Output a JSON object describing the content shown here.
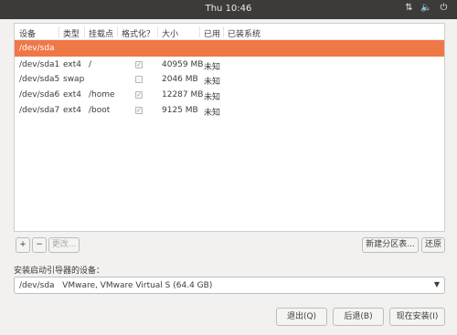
{
  "topbar": {
    "clock": "Thu 10:46",
    "icons": [
      "network-icon",
      "volume-icon",
      "power-icon"
    ]
  },
  "table": {
    "headers": [
      "设备",
      "类型",
      "挂载点",
      "格式化？",
      "大小",
      "已用",
      "已装系统"
    ],
    "selected_row": "/dev/sda",
    "rows": [
      {
        "device": "/dev/sda1",
        "type": "ext4",
        "mount": "/",
        "format": true,
        "size": "40959 MB",
        "used": "未知",
        "system": ""
      },
      {
        "device": "/dev/sda5",
        "type": "swap",
        "mount": "",
        "format": false,
        "size": "2046 MB",
        "used": "未知",
        "system": ""
      },
      {
        "device": "/dev/sda6",
        "type": "ext4",
        "mount": "/home",
        "format": true,
        "size": "12287 MB",
        "used": "未知",
        "system": ""
      },
      {
        "device": "/dev/sda7",
        "type": "ext4",
        "mount": "/boot",
        "format": true,
        "size": "9125 MB",
        "used": "未知",
        "system": ""
      }
    ]
  },
  "toolbar": {
    "add": "+",
    "remove": "−",
    "change": "更改...",
    "new_table": "新建分区表...",
    "revert": "还原"
  },
  "bootloader": {
    "label": "安装启动引导器的设备：",
    "device": "/dev/sda",
    "description": "VMware, VMware Virtual S (64.4 GB)"
  },
  "actions": {
    "quit": "退出(Q)",
    "back": "后退(B)",
    "install": "现在安装(I)"
  },
  "colors": {
    "accent": "#f07746",
    "topbar": "#3c3b37"
  }
}
